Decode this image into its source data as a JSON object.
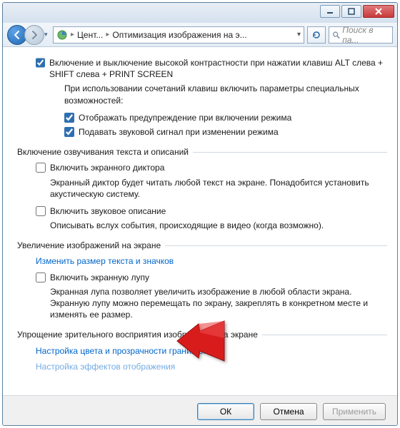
{
  "titlebar": {
    "minimize": "–",
    "maximize": "▢",
    "close": "✕"
  },
  "nav": {
    "crumb1": "Цент...",
    "crumb2": "Оптимизация изображения на э...",
    "search_placeholder": "Поиск в па..."
  },
  "top_section": {
    "high_contrast_label": "Включение и выключение высокой контрастности при нажатии клавиш ALT слева + SHIFT слева + PRINT SCREEN",
    "sub_intro": "При использовании сочетаний клавиш включить параметры специальных возможностей:",
    "warn_label": "Отображать предупреждение при включении режима",
    "sound_label": "Подавать звуковой сигнал при изменении режима"
  },
  "narration": {
    "legend": "Включение озвучивания текста и описаний",
    "narrator_label": "Включить экранного диктора",
    "narrator_desc": "Экранный диктор будет читать любой текст на экране. Понадобится установить акустическую систему.",
    "audio_desc_label": "Включить звуковое описание",
    "audio_desc_desc": "Описывать вслух события, происходящие в видео (когда возможно)."
  },
  "magnify": {
    "legend": "Увеличение изображений на экране",
    "link_text": "Изменить размер текста и значков",
    "magnifier_label": "Включить экранную лупу",
    "magnifier_desc": "Экранная лупа позволяет увеличить изображение в любой области экрана. Экранную лупу можно перемещать по экрану, закреплять в конкретном месте и изменять ее размер."
  },
  "visual": {
    "legend": "Упрощение зрительного восприятия изображений на экране",
    "link_color": "Настройка цвета и прозрачности границ окна",
    "link_effects": "Настройка эффектов отображения"
  },
  "buttons": {
    "ok": "ОК",
    "cancel": "Отмена",
    "apply": "Применить"
  }
}
